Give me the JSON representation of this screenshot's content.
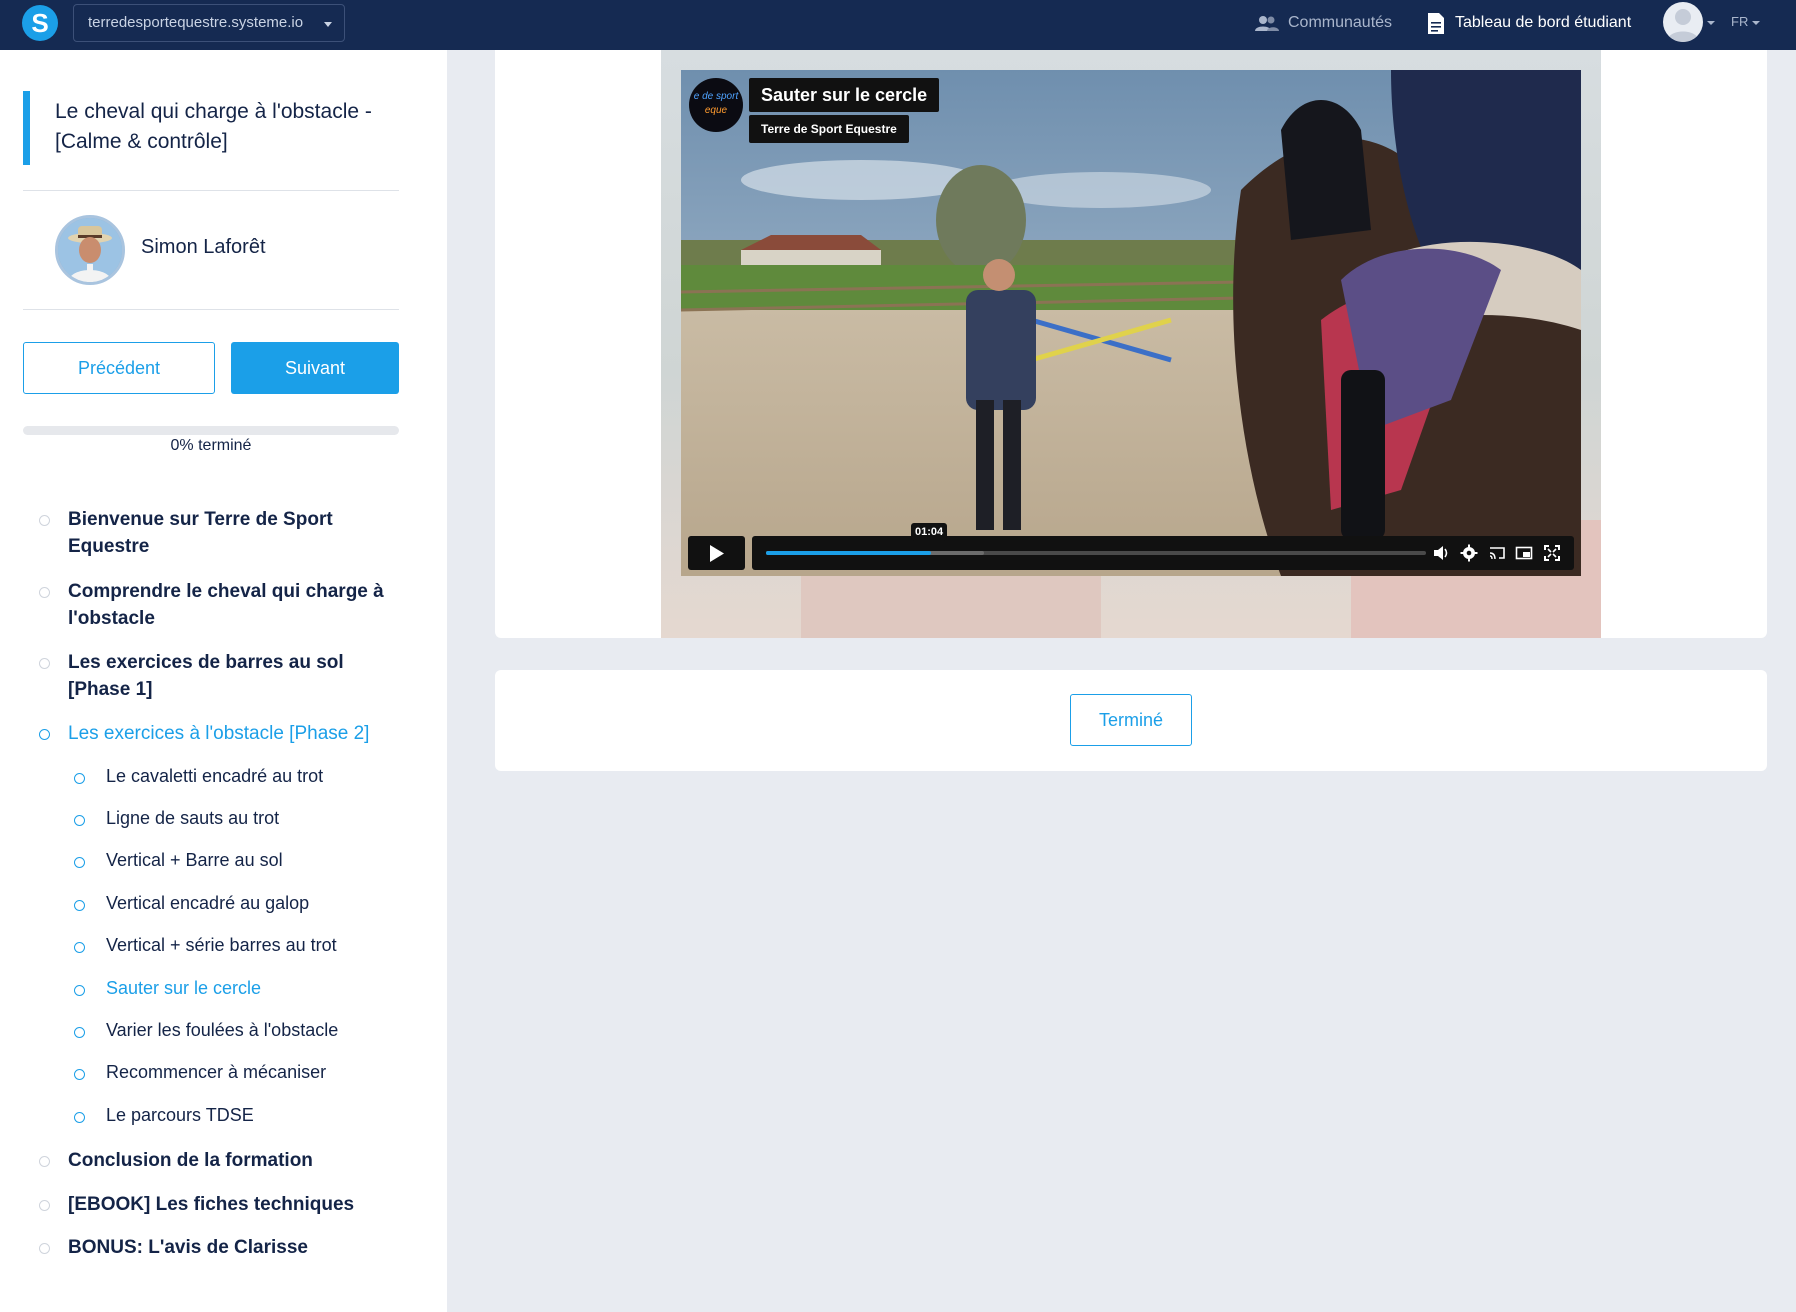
{
  "brand": {
    "accent": "#1b9fe8",
    "navy": "#152a52",
    "text": "#142447"
  },
  "topbar": {
    "logo_letter": "S",
    "site_domain": "terredesportequestre.systeme.io",
    "communities_label": "Communautés",
    "dashboard_label": "Tableau de bord étudiant",
    "language": "FR"
  },
  "sidebar": {
    "course_title": "Le cheval qui charge à l'obstacle - [Calme & contrôle]",
    "author_name": "Simon Laforêt",
    "prev_label": "Précédent",
    "next_label": "Suivant",
    "progress_percent": 0,
    "progress_text": "0% terminé",
    "modules": [
      {
        "title": "Bienvenue sur Terre de Sport Equestre",
        "active": false
      },
      {
        "title": "Comprendre le cheval qui charge à l'obstacle",
        "active": false
      },
      {
        "title": "Les exercices de barres au sol [Phase 1]",
        "active": false
      },
      {
        "title": "Les exercices à l'obstacle [Phase 2]",
        "active": true,
        "lessons": [
          {
            "title": "Le cavaletti encadré au trot",
            "active": false
          },
          {
            "title": "Ligne de sauts au trot",
            "active": false
          },
          {
            "title": "Vertical + Barre au sol",
            "active": false
          },
          {
            "title": "Vertical encadré au galop",
            "active": false
          },
          {
            "title": "Vertical + série barres au trot",
            "active": false
          },
          {
            "title": "Sauter sur le cercle",
            "active": true
          },
          {
            "title": "Varier les foulées à l'obstacle",
            "active": false
          },
          {
            "title": "Recommencer à mécaniser",
            "active": false
          },
          {
            "title": "Le parcours TDSE",
            "active": false
          }
        ]
      },
      {
        "title": "Conclusion de la formation",
        "active": false
      },
      {
        "title": "[EBOOK] Les fiches techniques",
        "active": false
      },
      {
        "title": "BONUS: L'avis de Clarisse",
        "active": false
      }
    ]
  },
  "video": {
    "title": "Sauter sur le cercle",
    "channel": "Terre de Sport Equestre",
    "channel_logo_text": "e de sport",
    "channel_logo_text2": "eque",
    "current_time": "01:04",
    "played_fraction": 0.25,
    "buffered_fraction": 0.33
  },
  "complete_button_label": "Terminé"
}
